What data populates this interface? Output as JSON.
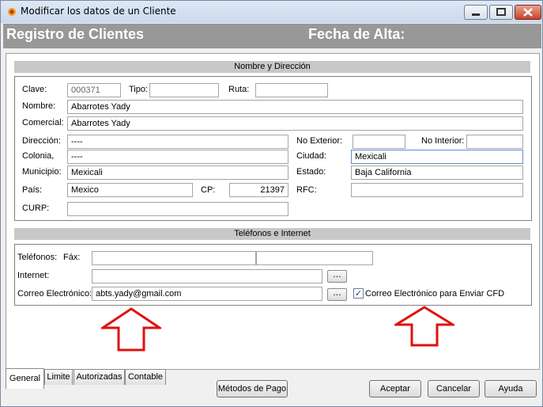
{
  "window": {
    "title": "Modificar los datos de un Cliente"
  },
  "header": {
    "left": "Registro de Clientes",
    "right": "Fecha de Alta:"
  },
  "sections": {
    "address": "Nombre y Dirección",
    "phones": "Teléfonos e Internet"
  },
  "labels": {
    "clave": "Clave:",
    "tipo": "Tipo:",
    "ruta": "Ruta:",
    "nombre": "Nombre:",
    "comercial": "Comercial:",
    "direccion": "Dirección:",
    "no_exterior": "No Exterior:",
    "no_interior": "No Interior:",
    "colonia": "Colonia,",
    "ciudad": "Ciudad:",
    "municipio": "Municipio:",
    "estado": "Estado:",
    "pais": "País:",
    "cp": "CP:",
    "rfc": "RFC:",
    "curp": "CURP:",
    "telefonos": "Teléfonos:",
    "fax": "Fáx:",
    "internet": "Internet:",
    "correo": "Correo Electrónico:",
    "correo_cfd": "Correo Electrónico para Enviar CFD"
  },
  "values": {
    "clave": "000371",
    "tipo": "",
    "ruta": "",
    "nombre": "Abarrotes Yady",
    "comercial": "Abarrotes Yady",
    "direccion": "----",
    "no_exterior": "",
    "no_interior": "",
    "colonia": "----",
    "ciudad": "Mexicali",
    "municipio": "Mexicali",
    "estado": "Baja California",
    "pais": "Mexico",
    "cp": "21397",
    "rfc": "",
    "curp": "",
    "telefonos": "",
    "fax": "",
    "internet": "",
    "correo": "abts.yady@gmail.com",
    "correo_cfd_checked": "✓"
  },
  "browse_label": "...",
  "tabs": [
    "General",
    "Limite",
    "Autorizadas",
    "Contable"
  ],
  "buttons": {
    "metodos": "Métodos de Pago",
    "aceptar": "Aceptar",
    "cancelar": "Cancelar",
    "ayuda": "Ayuda"
  },
  "colors": {
    "arrow": "#e01010",
    "header_text": "#ffffff"
  }
}
